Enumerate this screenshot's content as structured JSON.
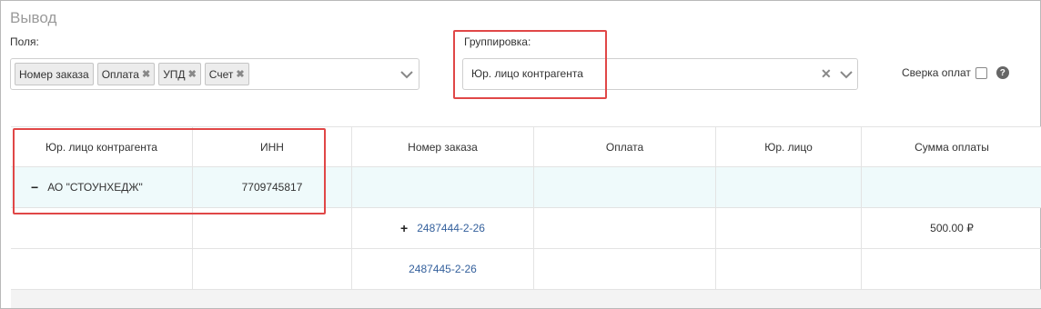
{
  "section_title": "Вывод",
  "fields": {
    "label": "Поля:",
    "tags": [
      "Номер заказа",
      "Оплата",
      "УПД",
      "Счет"
    ],
    "tag_removable": [
      false,
      true,
      true,
      true
    ]
  },
  "grouping": {
    "label": "Группировка:",
    "value": "Юр. лицо контрагента"
  },
  "reconciliation": {
    "label": "Сверка оплат",
    "checked": false,
    "help_glyph": "?"
  },
  "table": {
    "headers": [
      "Юр. лицо контрагента",
      "ИНН",
      "Номер заказа",
      "Оплата",
      "Юр. лицо",
      "Сумма оплаты"
    ],
    "group_row": {
      "toggle_glyph": "−",
      "counterparty": "АО \"СТОУНХЕДЖ\"",
      "inn": "7709745817"
    },
    "rows": [
      {
        "toggle_glyph": "+",
        "order": "2487444-2-26",
        "payment": "",
        "legal_entity": "",
        "amount": "500.00 ₽"
      },
      {
        "toggle_glyph": "",
        "order": "2487445-2-26",
        "payment": "",
        "legal_entity": "",
        "amount": ""
      }
    ]
  },
  "colors": {
    "highlight_box": "#e04747",
    "group_row_bg": "#effafb",
    "link": "#34609c"
  },
  "icons": [
    "close-icon",
    "chevron-down-icon",
    "help-icon",
    "minus-icon",
    "plus-icon"
  ]
}
